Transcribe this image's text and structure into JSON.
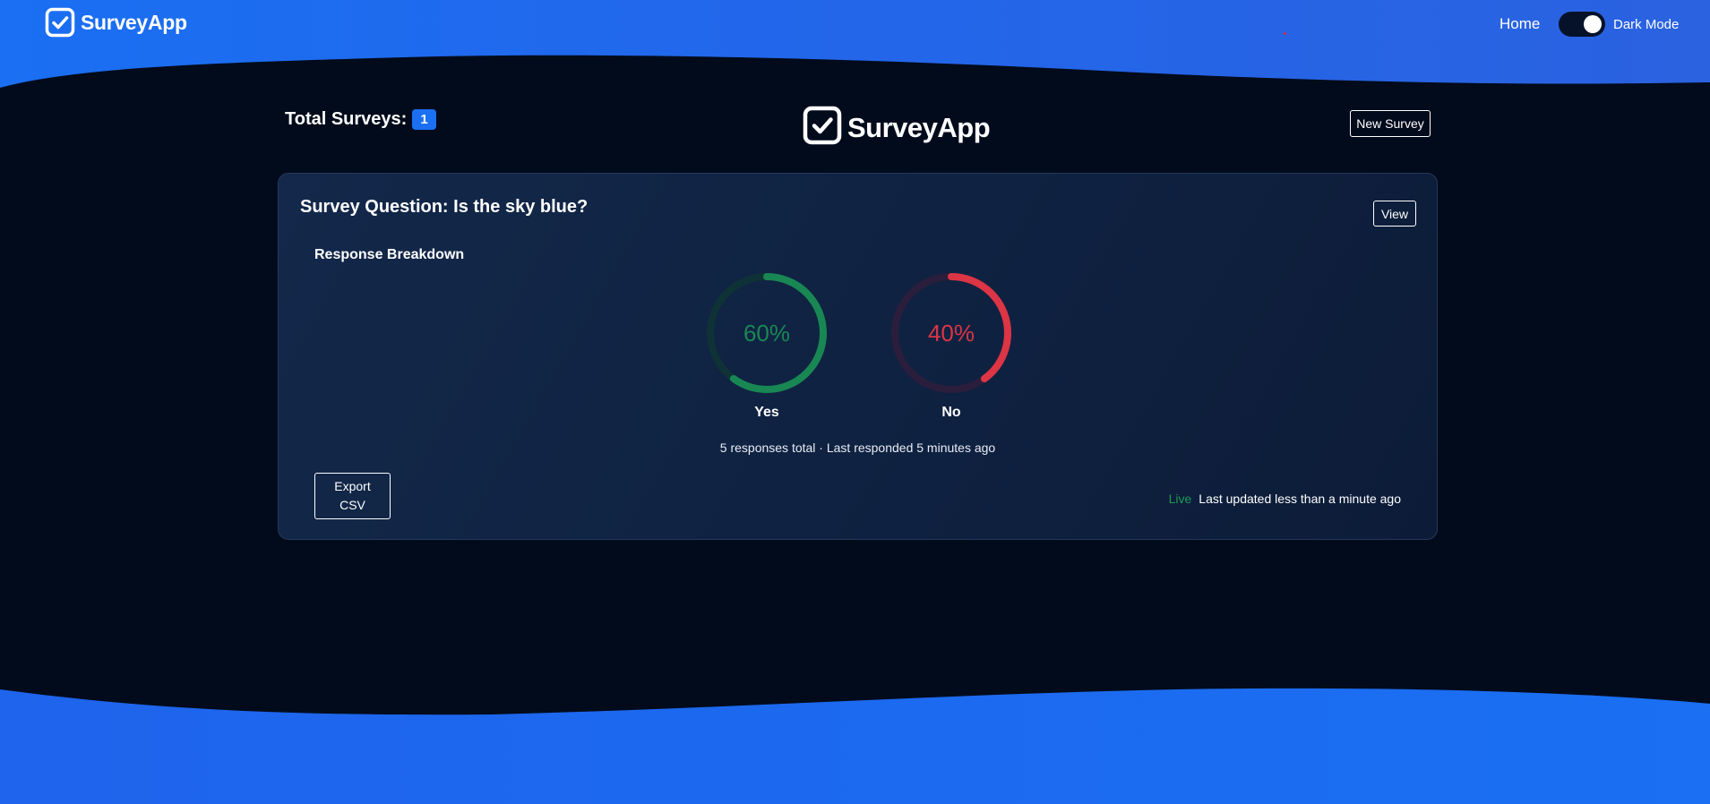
{
  "nav": {
    "brand": "SurveyApp",
    "home": "Home",
    "dark_mode_label": "Dark Mode",
    "dark_mode_on": true
  },
  "header": {
    "total_label": "Total Surveys:",
    "total_count": "1",
    "logo_text": "SurveyApp",
    "new_survey_label": "New Survey"
  },
  "survey": {
    "title": "Survey Question: Is the sky blue?",
    "view_label": "View",
    "breakdown_title": "Response Breakdown",
    "responses": [
      {
        "label": "Yes",
        "percent": 60,
        "percent_text": "60%",
        "color": "#198754",
        "track_color": "#0f3236"
      },
      {
        "label": "No",
        "percent": 40,
        "percent_text": "40%",
        "color": "#dc3545",
        "track_color": "#2a1e3c"
      }
    ],
    "summary": "5 responses total · Last responded 5 minutes ago",
    "export_label": "Export CSV",
    "live_label": "Live",
    "updated_text": "Last updated less than a minute ago"
  },
  "colors": {
    "accent": "#1a6ff2",
    "background": "#020b1c",
    "card": "#12264a"
  },
  "icons": {
    "brand": "checkbox-check-icon"
  }
}
